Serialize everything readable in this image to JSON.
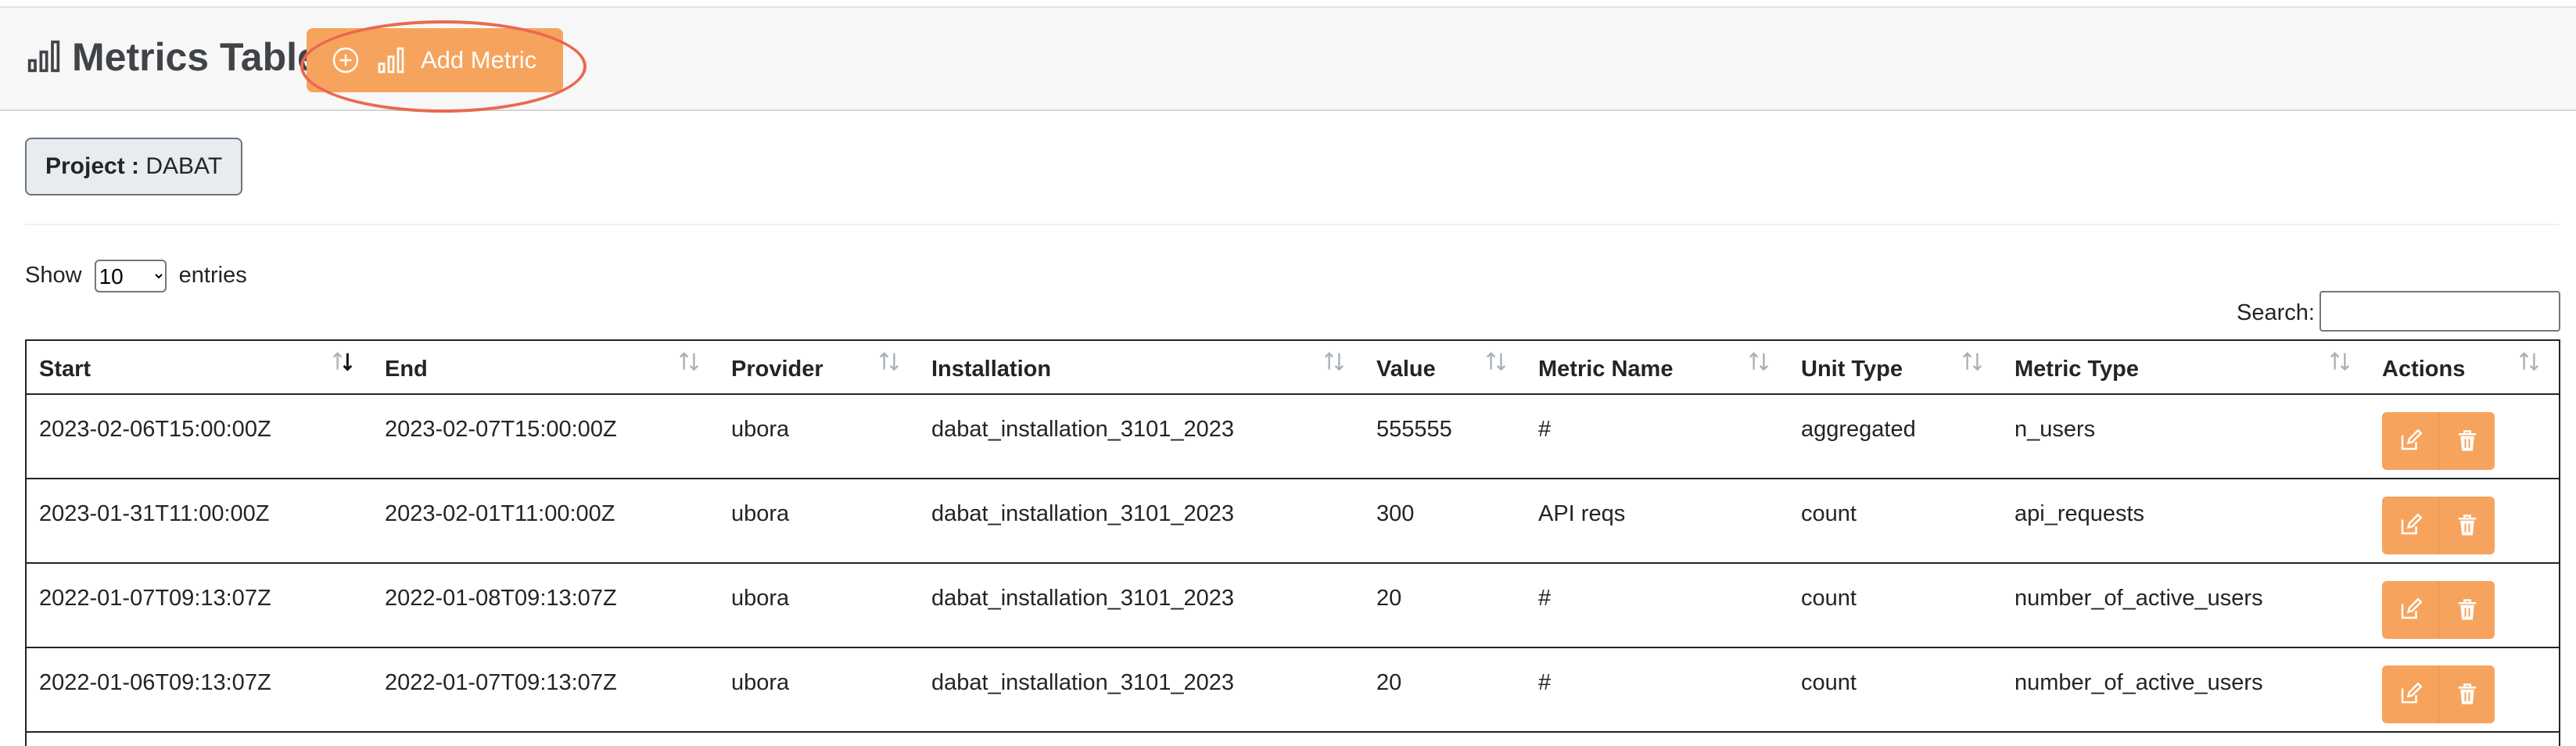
{
  "header": {
    "title": "Metrics Table",
    "title_icon": "bar-chart-icon",
    "add_button_label": "Add Metric",
    "add_button_icons": [
      "plus-circle-icon",
      "bar-chart-icon"
    ],
    "accent_color": "#f6a45d",
    "highlight_color": "#ea6850"
  },
  "project": {
    "label": "Project :",
    "value": "DABAT"
  },
  "controls": {
    "show_label": "Show",
    "entries_value": "10",
    "entries_label": "entries",
    "search_label": "Search:",
    "search_value": ""
  },
  "table": {
    "columns": [
      {
        "label": "Start",
        "sort": "desc"
      },
      {
        "label": "End",
        "sort": "none"
      },
      {
        "label": "Provider",
        "sort": "none"
      },
      {
        "label": "Installation",
        "sort": "none"
      },
      {
        "label": "Value",
        "sort": "none"
      },
      {
        "label": "Metric Name",
        "sort": "none"
      },
      {
        "label": "Unit Type",
        "sort": "none"
      },
      {
        "label": "Metric Type",
        "sort": "none"
      },
      {
        "label": "Actions",
        "sort": "none"
      }
    ],
    "rows": [
      [
        "2023-02-06T15:00:00Z",
        "2023-02-07T15:00:00Z",
        "ubora",
        "dabat_installation_3101_2023",
        "555555",
        "#",
        "aggregated",
        "n_users"
      ],
      [
        "2023-01-31T11:00:00Z",
        "2023-02-01T11:00:00Z",
        "ubora",
        "dabat_installation_3101_2023",
        "300",
        "API reqs",
        "count",
        "api_requests"
      ],
      [
        "2022-01-07T09:13:07Z",
        "2022-01-08T09:13:07Z",
        "ubora",
        "dabat_installation_3101_2023",
        "20",
        "#",
        "count",
        "number_of_active_users"
      ],
      [
        "2022-01-06T09:13:07Z",
        "2022-01-07T09:13:07Z",
        "ubora",
        "dabat_installation_3101_2023",
        "20",
        "#",
        "count",
        "number_of_active_users"
      ]
    ],
    "action_icons": [
      "edit-icon",
      "trash-icon"
    ]
  }
}
